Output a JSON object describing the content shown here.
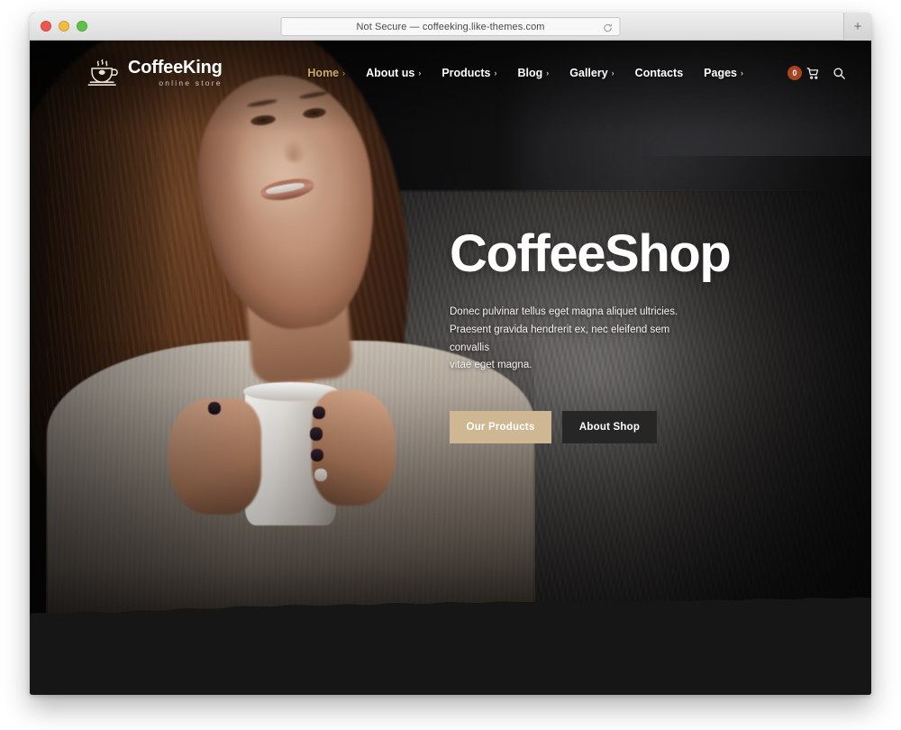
{
  "browser": {
    "url_text": "Not Secure — coffeeking.like-themes.com",
    "reload_label": "↻",
    "newtab_label": "+",
    "traffic_lights": [
      "close",
      "minimize",
      "zoom"
    ]
  },
  "site": {
    "logo": {
      "name": "CoffeeKing",
      "tagline": "online store",
      "icon": "coffee-cup-icon"
    },
    "nav": [
      {
        "label": "Home",
        "caret": "›",
        "active": true
      },
      {
        "label": "About us",
        "caret": "›",
        "active": false
      },
      {
        "label": "Products",
        "caret": "›",
        "active": false
      },
      {
        "label": "Blog",
        "caret": "›",
        "active": false
      },
      {
        "label": "Gallery",
        "caret": "›",
        "active": false
      },
      {
        "label": "Contacts",
        "caret": "",
        "active": false
      },
      {
        "label": "Pages",
        "caret": "›",
        "active": false
      }
    ],
    "tools": {
      "cart_count": "0",
      "cart_icon": "shopping-cart-icon",
      "search_icon": "search-icon"
    },
    "accent_color": "#c9a96a",
    "badge_color": "#a8441f",
    "primary_button_color": "#cfb793",
    "secondary_button_color": "#262626"
  },
  "hero": {
    "title": "CoffeeShop",
    "description_lines": [
      "Donec pulvinar tellus eget magna aliquet ultricies.",
      "Praesent gravida hendrerit ex, nec eleifend sem convallis",
      "vitae eget magna."
    ],
    "buttons": [
      {
        "label": "Our Products",
        "style": "primary"
      },
      {
        "label": "About Shop",
        "style": "secondary"
      }
    ],
    "background_image": "woman-holding-white-coffee-mug-on-fur-blanket"
  }
}
